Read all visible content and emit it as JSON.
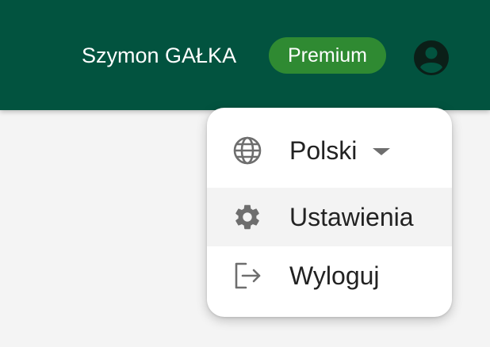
{
  "header": {
    "user_name": "Szymon GAŁKA",
    "plan_badge": "Premium",
    "colors": {
      "bar": "#02533f",
      "badge": "#2f8a32",
      "avatar": "#0b1f18"
    },
    "avatar_icon": "account-circle-icon"
  },
  "user_menu": {
    "items": [
      {
        "label": "Polski",
        "icon": "globe-icon",
        "has_dropdown": true
      },
      {
        "label": "Ustawienia",
        "icon": "gear-icon",
        "highlighted": true
      },
      {
        "label": "Wyloguj",
        "icon": "logout-icon"
      }
    ]
  }
}
